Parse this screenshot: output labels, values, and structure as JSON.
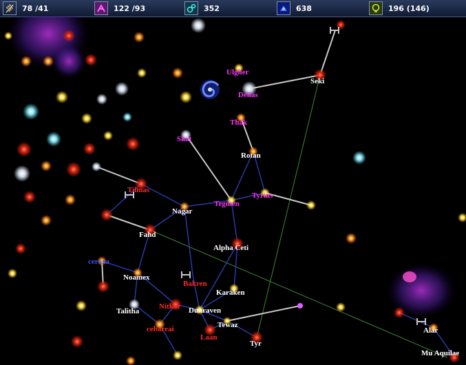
{
  "resources": [
    {
      "icon": "wheat-icon",
      "value": "78 /41",
      "color": "#c9b28a"
    },
    {
      "icon": "research-icon",
      "value": "122 /93",
      "color": "#cc44cc"
    },
    {
      "icon": "industry-icon",
      "value": "352",
      "color": "#44cccc"
    },
    {
      "icon": "credits-icon",
      "value": "638",
      "color": "#3355ff"
    },
    {
      "icon": "bulb-icon",
      "value": "196 (146)",
      "color": "#aacc33"
    }
  ],
  "systems": [
    {
      "name": "Ulgher",
      "color": "m"
    },
    {
      "name": "Dellas",
      "color": "m"
    },
    {
      "name": "Seki",
      "color": "w"
    },
    {
      "name": "Thak",
      "color": "m"
    },
    {
      "name": "Skat",
      "color": "m"
    },
    {
      "name": "Rotan",
      "color": "w"
    },
    {
      "name": "Tilmas",
      "color": "r"
    },
    {
      "name": "Tyrius",
      "color": "m"
    },
    {
      "name": "Nagar",
      "color": "w"
    },
    {
      "name": "Tegmen",
      "color": "m"
    },
    {
      "name": "Fahd",
      "color": "w"
    },
    {
      "name": "Alpha Ceti",
      "color": "w"
    },
    {
      "name": "ceroxa",
      "color": "b"
    },
    {
      "name": "Noamex",
      "color": "w"
    },
    {
      "name": "Bakren",
      "color": "r"
    },
    {
      "name": "Karaken",
      "color": "w"
    },
    {
      "name": "Nitkar",
      "color": "r"
    },
    {
      "name": "Talitha",
      "color": "w"
    },
    {
      "name": "Dunraven",
      "color": "w"
    },
    {
      "name": "cebarrai",
      "color": "r"
    },
    {
      "name": "Tewaz",
      "color": "w"
    },
    {
      "name": "Laan",
      "color": "r"
    },
    {
      "name": "Tyr",
      "color": "w"
    },
    {
      "name": "Alar",
      "color": "w"
    },
    {
      "name": "Mu Aquilae",
      "color": "w"
    }
  ]
}
